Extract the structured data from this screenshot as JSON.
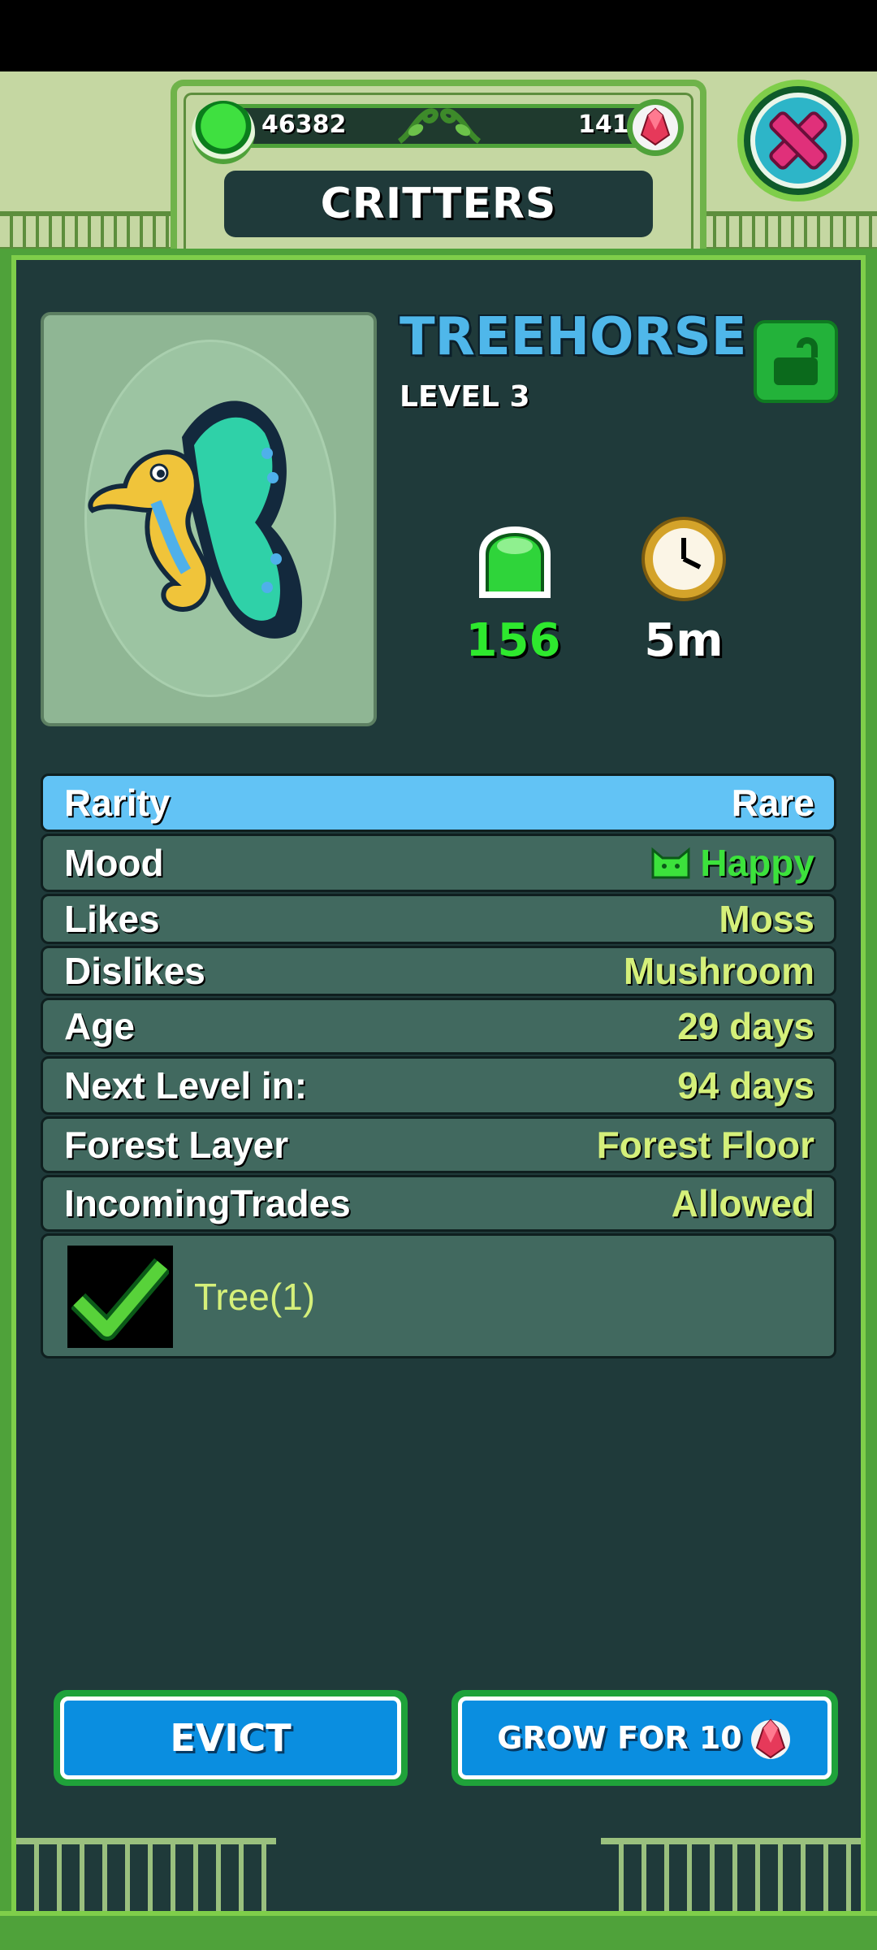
{
  "header": {
    "green_gems": "46382",
    "red_gems": "141",
    "title": "CRITTERS"
  },
  "critter": {
    "name": "TREEHORSE",
    "level": "LEVEL 3",
    "gem_output": "156",
    "time": "5m"
  },
  "details": [
    {
      "label": "Rarity",
      "value": "Rare"
    },
    {
      "label": "Mood",
      "value": "Happy"
    },
    {
      "label": "Likes",
      "value": "Moss"
    },
    {
      "label": "Dislikes",
      "value": "Mushroom"
    },
    {
      "label": "Age",
      "value": "29 days"
    },
    {
      "label": "Next Level in:",
      "value": "94 days"
    },
    {
      "label": "Forest Layer",
      "value": "Forest Floor"
    },
    {
      "label": "IncomingTrades",
      "value": "Allowed"
    }
  ],
  "trade_requirement": {
    "label": "Tree(1)",
    "met": true
  },
  "buttons": {
    "evict": "EVICT",
    "grow": "GROW FOR 10"
  },
  "icons": {
    "currency_green": "green-gem-icon",
    "currency_red": "red-crystal-icon",
    "close": "close-icon",
    "lock": "unlocked-padlock-icon",
    "clock": "clock-icon",
    "mood": "cat-face-icon",
    "check": "checkmark-icon"
  },
  "colors": {
    "frame_green": "#4fa23a",
    "panel_dark": "#1f3a3a",
    "row_bg": "#41695f",
    "row_highlight": "#62c3f5",
    "name_blue": "#4fb7ea",
    "value_yellow": "#d5f07a",
    "happy_green": "#3ce23c",
    "button_blue": "#0a8ee0"
  }
}
